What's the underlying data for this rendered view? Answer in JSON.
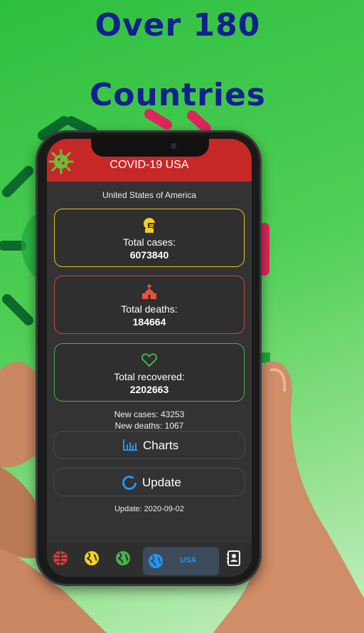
{
  "promo": {
    "line1": "Over 180",
    "line2": "Countries"
  },
  "app": {
    "title": "COVID-19 USA",
    "country": "United States of America",
    "cards": {
      "cases": {
        "label": "Total cases:",
        "value": "6073840",
        "color": "#e3c21c"
      },
      "deaths": {
        "label": "Total deaths:",
        "value": "184664",
        "color": "#c94a3b"
      },
      "recovered": {
        "label": "Total recovered:",
        "value": "2202663",
        "color": "#4caf50"
      }
    },
    "new_cases": "New cases: 43253",
    "new_deaths": "New deaths: 1067",
    "buttons": {
      "charts": "Charts",
      "update": "Update"
    },
    "update_date": "Update: 2020-09-02",
    "bottom_nav": {
      "items": [
        "globe-red-icon",
        "globe-yellow-icon",
        "globe-green-icon",
        "globe-blue-icon",
        "contacts-icon"
      ],
      "active_label": "USA"
    },
    "colors": {
      "appbar": "#c62828",
      "accent_blue": "#2196f3",
      "screen_bg": "#333333"
    }
  }
}
